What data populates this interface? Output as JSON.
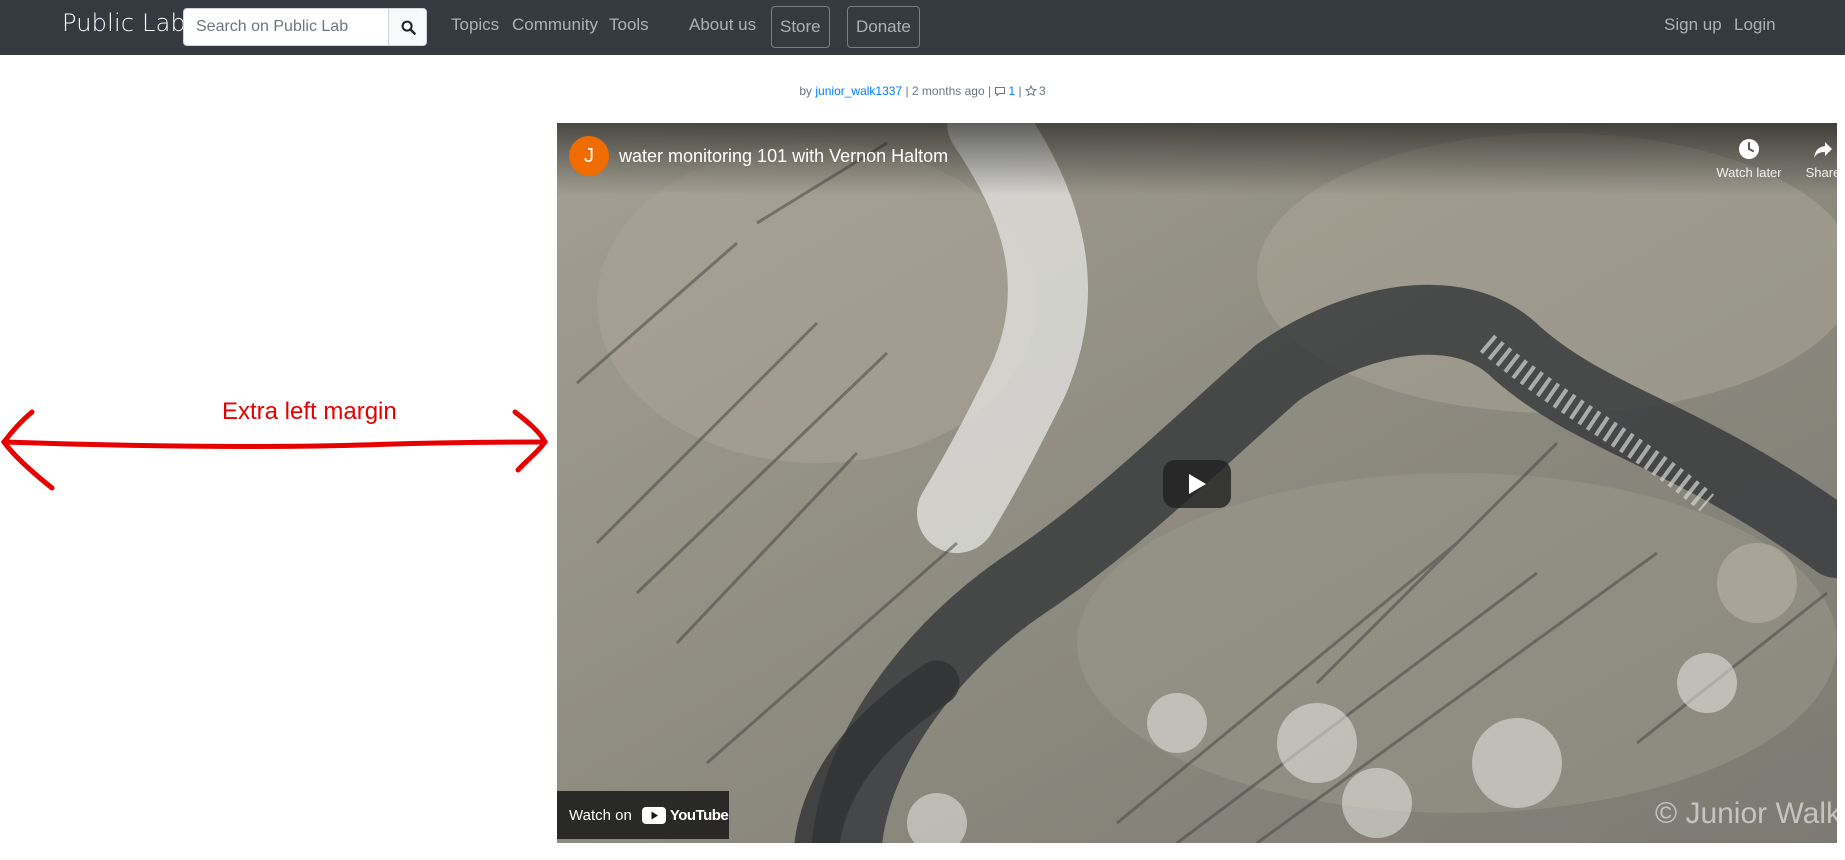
{
  "navbar": {
    "brand": "Public Lab",
    "search_placeholder": "Search on Public Lab",
    "links": {
      "topics": "Topics",
      "community": "Community",
      "tools": "Tools",
      "about": "About us",
      "store": "Store",
      "donate": "Donate",
      "signup": "Sign up",
      "login": "Login"
    }
  },
  "byline": {
    "prefix": "by",
    "author": "junior_walk1337",
    "time": "| 2 months ago |",
    "comments": "1",
    "separator": "|",
    "likes": "3"
  },
  "annotation": {
    "label": "Extra left margin",
    "color": "#e80000"
  },
  "video": {
    "channel_initial": "J",
    "title": "water monitoring 101 with Vernon Haltom",
    "watch_later": "Watch later",
    "share": "Share",
    "watch_on": "Watch on",
    "youtube": "YouTube",
    "watermark": "© Junior Walk"
  },
  "colors": {
    "navbar_bg": "#343a40",
    "link": "#007bff",
    "avatar": "#ef6c00"
  }
}
